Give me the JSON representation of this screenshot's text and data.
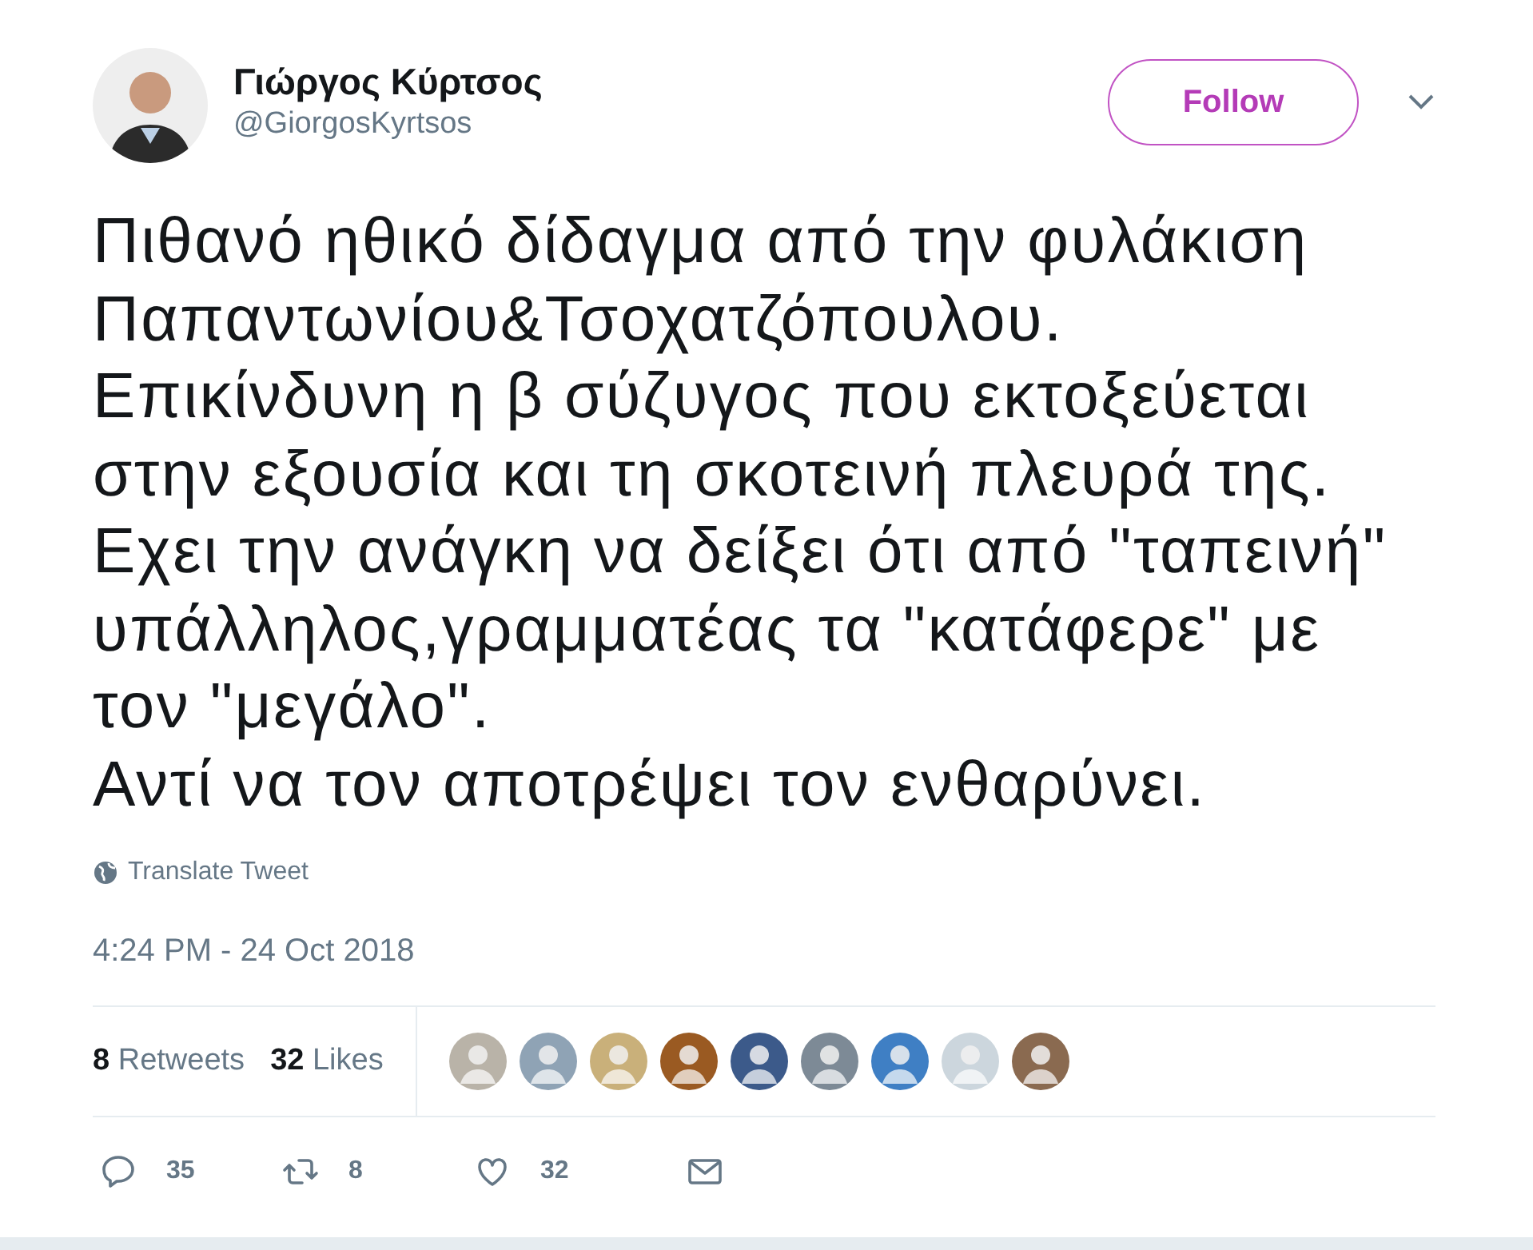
{
  "author": {
    "name": "Γιώργος Κύρτσος",
    "handle": "@GiorgosKyrtsos"
  },
  "follow_button": {
    "label": "Follow"
  },
  "tweet_lines": [
    "Πιθανό ηθικό δίδαγμα από την φυλάκιση",
    "Παπαντωνίου&Τσοχατζόπουλου.",
    "Επικίνδυνη η β σύζυγος που εκτοξεύεται",
    "στην εξουσία και τη σκοτεινή πλευρά της.",
    "Εχει την ανάγκη να δείξει ότι από \"ταπεινή\"",
    "υπάλληλος,γραμματέας τα \"κατάφερε\" με",
    "τον \"μεγάλο\".",
    "Αντί να τον αποτρέψει τον ενθαρύνει."
  ],
  "translate_link": "Translate Tweet",
  "timestamp": "4:24 PM - 24 Oct 2018",
  "stats": [
    {
      "count": "8",
      "label": "Retweets"
    },
    {
      "count": "32",
      "label": "Likes"
    }
  ],
  "likers": [
    {
      "color": "#b9b3a8"
    },
    {
      "color": "#8fa3b5"
    },
    {
      "color": "#c9b07a"
    },
    {
      "color": "#9a5a22"
    },
    {
      "color": "#3c5a8a"
    },
    {
      "color": "#7d8a96"
    },
    {
      "color": "#3f7fc4"
    },
    {
      "color": "#ccd6dd"
    },
    {
      "color": "#8a6a50"
    }
  ],
  "actions": [
    {
      "kind": "reply",
      "count": "35"
    },
    {
      "kind": "retweet",
      "count": "8"
    },
    {
      "kind": "like",
      "count": "32"
    },
    {
      "kind": "message"
    }
  ]
}
